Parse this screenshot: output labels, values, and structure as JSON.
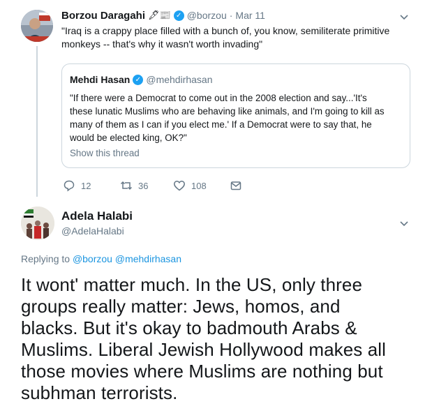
{
  "tweet1": {
    "author_name": "Borzou Daragahi",
    "emoji": "🖋📰",
    "handle": "@borzou",
    "separator": "·",
    "date": "Mar 11",
    "text_line1": "\"Iraq is a crappy place filled with a bunch of, you know, semiliterate primitive",
    "text_line2": "monkeys -- that's why it wasn't worth invading\"",
    "quote": {
      "author_name": "Mehdi Hasan",
      "handle": "@mehdirhasan",
      "line1": "\"If there were a Democrat to come out in the 2008 election and say...'It's",
      "line2": "these lunatic Muslims who are behaving like animals, and I'm going to kill as",
      "line3": "many of them as I can if you elect me.' If a Democrat were to say that, he",
      "line4": "would be elected king, OK?\"",
      "show_thread": "Show this thread"
    },
    "actions": {
      "replies": "12",
      "retweets": "36",
      "likes": "108"
    }
  },
  "tweet2": {
    "author_name": "Adela Halabi",
    "handle": "@AdelaHalabi",
    "replying_to_label": "Replying to",
    "replying_to_1": "@borzou",
    "replying_to_2": "@mehdirhasan",
    "line1": "It wont' matter much. In the US, only three",
    "line2": "groups really matter: Jews, homos, and",
    "line3": "blacks. But it's okay to badmouth Arabs &",
    "line4": "Muslims. Liberal Jewish Hollywood makes all",
    "line5": "those movies where Muslims are nothing but",
    "line6": "subhman terrorists."
  },
  "colors": {
    "accent": "#1da1f2",
    "link": "#1b95e0",
    "muted": "#657786",
    "border": "#ccd6dd"
  }
}
